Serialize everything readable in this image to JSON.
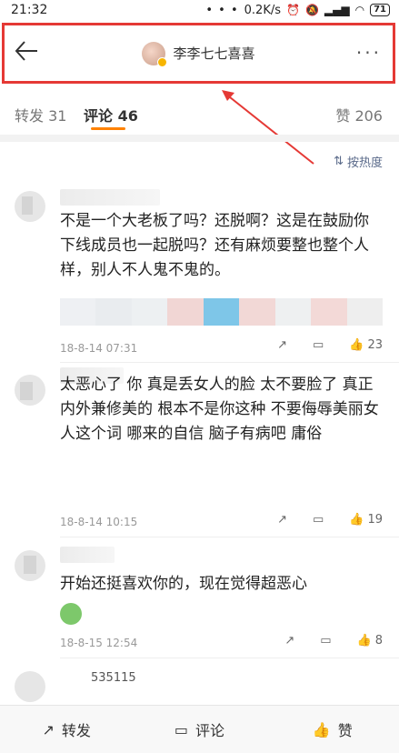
{
  "status": {
    "time": "21:32",
    "dots": "• • •",
    "speed": "0.2K/s",
    "battery": "71"
  },
  "header": {
    "title": "李李七七喜喜"
  },
  "tabs": [
    {
      "label": "转发 31"
    },
    {
      "label": "评论 46"
    },
    {
      "label": "赞 206"
    }
  ],
  "sort_label": "按热度",
  "comments": [
    {
      "text": "不是一个大老板了吗？还脱啊？这是在鼓励你下线成员也一起脱吗？还有麻烦要整也整个人样，别人不人鬼不鬼的。",
      "time": "18-8-14 07:31",
      "likes": "23"
    },
    {
      "text": "太恶心了 你 真是丢女人的脸 太不要脸了 真正内外兼修美的 根本不是你这种 不要侮辱美丽女人这个词 哪来的自信 脑子有病吧 庸俗",
      "time": "18-8-14 10:15",
      "likes": "19"
    },
    {
      "text": "开始还挺喜欢你的，现在觉得超恶心",
      "time": "18-8-15 12:54",
      "likes": "8"
    }
  ],
  "partial_name": "535115",
  "bottom": {
    "repost": "转发",
    "comment": "评论",
    "like": "赞"
  },
  "colors": {
    "accent": "#ff8200",
    "highlight": "#e53935"
  }
}
